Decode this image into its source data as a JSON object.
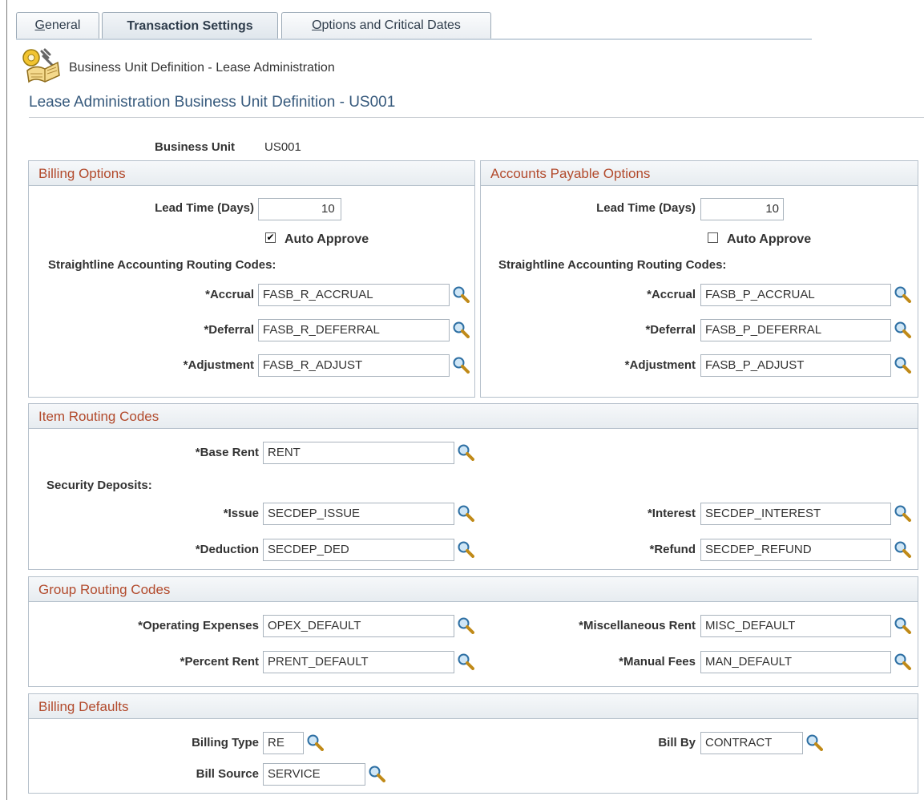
{
  "tabs": [
    {
      "label": "General",
      "accel": "G",
      "rest": "eneral"
    },
    {
      "label": "Transaction Settings"
    },
    {
      "label": "Options and Critical Dates",
      "accel": "O",
      "rest": "ptions and Critical Dates"
    }
  ],
  "breadcrumb": "Business Unit Definition - Lease Administration",
  "page_title": "Lease Administration Business Unit Definition - US001",
  "business_unit": {
    "label": "Business Unit",
    "value": "US001"
  },
  "billing_options": {
    "title": "Billing Options",
    "lead_time_label": "Lead Time (Days)",
    "lead_time_value": "10",
    "auto_approve_label": "Auto Approve",
    "auto_approve_checked": true,
    "straightline_label": "Straightline Accounting Routing Codes:",
    "accrual_label": "*Accrual",
    "accrual_value": "FASB_R_ACCRUAL",
    "deferral_label": "*Deferral",
    "deferral_value": "FASB_R_DEFERRAL",
    "adjustment_label": "*Adjustment",
    "adjustment_value": "FASB_R_ADJUST"
  },
  "ap_options": {
    "title": "Accounts Payable Options",
    "lead_time_label": "Lead Time (Days)",
    "lead_time_value": "10",
    "auto_approve_label": "Auto Approve",
    "auto_approve_checked": false,
    "straightline_label": "Straightline Accounting Routing Codes:",
    "accrual_label": "*Accrual",
    "accrual_value": "FASB_P_ACCRUAL",
    "deferral_label": "*Deferral",
    "deferral_value": "FASB_P_DEFERRAL",
    "adjustment_label": "*Adjustment",
    "adjustment_value": "FASB_P_ADJUST"
  },
  "item_routing": {
    "title": "Item Routing Codes",
    "base_rent_label": "*Base Rent",
    "base_rent_value": "RENT",
    "security_deposits_label": "Security Deposits:",
    "issue_label": "*Issue",
    "issue_value": "SECDEP_ISSUE",
    "interest_label": "*Interest",
    "interest_value": "SECDEP_INTEREST",
    "deduction_label": "*Deduction",
    "deduction_value": "SECDEP_DED",
    "refund_label": "*Refund",
    "refund_value": "SECDEP_REFUND"
  },
  "group_routing": {
    "title": "Group Routing Codes",
    "opex_label": "*Operating Expenses",
    "opex_value": "OPEX_DEFAULT",
    "misc_label": "*Miscellaneous Rent",
    "misc_value": "MISC_DEFAULT",
    "percent_label": "*Percent Rent",
    "percent_value": "PRENT_DEFAULT",
    "manual_label": "*Manual Fees",
    "manual_value": "MAN_DEFAULT"
  },
  "billing_defaults": {
    "title": "Billing Defaults",
    "billing_type_label": "Billing Type",
    "billing_type_value": "RE",
    "bill_by_label": "Bill By",
    "bill_by_value": "CONTRACT",
    "bill_source_label": "Bill Source",
    "bill_source_value": "SERVICE"
  },
  "colors": {
    "section_header_text": "#b24a2c",
    "page_title": "#36597c",
    "border": "#b5c0cb"
  },
  "icons": {
    "lookup": "magnifier-icon",
    "page": "book-gear-icon"
  }
}
